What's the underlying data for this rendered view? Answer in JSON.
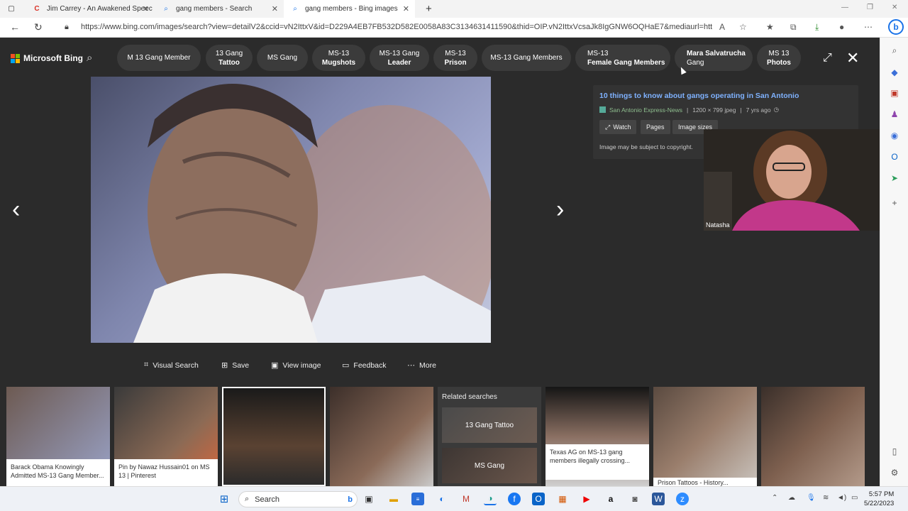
{
  "browser": {
    "tabs": [
      {
        "label": "Jim Carrey - An Awakened Speec",
        "icon": "circle-c-icon",
        "active": false
      },
      {
        "label": "gang members - Search",
        "icon": "search-icon",
        "active": false
      },
      {
        "label": "gang members - Bing images",
        "icon": "search-icon",
        "active": true
      }
    ],
    "new_tab": "+",
    "url": "https://www.bing.com/images/search?view=detailV2&ccid=vN2IttxV&id=D229A4EB7FB532D582E0058A83C3134631411590&thid=OIP.vN2IttxVcsaJk8IgGNW6OQHaE7&mediaurl=https%..."
  },
  "bing": {
    "logo_text": "Microsoft Bing",
    "colors": {
      "red": "#f25022",
      "green": "#7fba00",
      "blue": "#00a4ef",
      "yellow": "#ffb900"
    },
    "pills": [
      {
        "line1": "M 13 Gang Member",
        "line2": ""
      },
      {
        "line1": "13 Gang",
        "line2": "Tattoo"
      },
      {
        "line1": "MS Gang",
        "line2": ""
      },
      {
        "line1": "MS-13",
        "line2": "Mugshots"
      },
      {
        "line1": "MS-13 Gang",
        "line2": "Leader"
      },
      {
        "line1": "MS-13",
        "line2": "Prison"
      },
      {
        "line1": "MS-13 Gang Members",
        "line2": ""
      },
      {
        "line1": "MS-13",
        "line2": "Female Gang Members"
      },
      {
        "line1": "Mara Salvatrucha",
        "line2": "Gang"
      },
      {
        "line1": "MS 13",
        "line2": "Photos"
      }
    ]
  },
  "info": {
    "title": "10 things to know about gangs operating in San Antonio",
    "source": "San Antonio Express-News",
    "dimensions": "1200 × 799 jpeg",
    "age": "7 yrs ago",
    "buttons": [
      "Watch",
      "Pages",
      "Image sizes"
    ],
    "copyright": "Image may be subject to copyright."
  },
  "webcam": {
    "name": "Natasha"
  },
  "actions": [
    {
      "label": "Visual Search",
      "icon": "visual-search-icon"
    },
    {
      "label": "Save",
      "icon": "save-icon"
    },
    {
      "label": "View image",
      "icon": "view-image-icon"
    },
    {
      "label": "Feedback",
      "icon": "feedback-icon"
    },
    {
      "label": "More",
      "icon": "more-icon"
    }
  ],
  "thumbnails": [
    {
      "caption": "Barack Obama Knowingly Admitted MS-13 Gang Member..."
    },
    {
      "caption": "Pin by Nawaz Hussain01 on MS 13 | Pinterest"
    },
    {
      "caption": ""
    },
    {
      "caption": ""
    },
    {
      "caption": "Texas AG on MS-13 gang members illegally crossing..."
    },
    {
      "caption": "Prison Tattoos - History..."
    },
    {
      "caption": ""
    }
  ],
  "related": {
    "title": "Related searches",
    "items": [
      "13 Gang Tattoo",
      "MS Gang"
    ]
  },
  "taskbar": {
    "search_label": "Search",
    "time": "5:57 PM",
    "date": "5/22/2023"
  }
}
